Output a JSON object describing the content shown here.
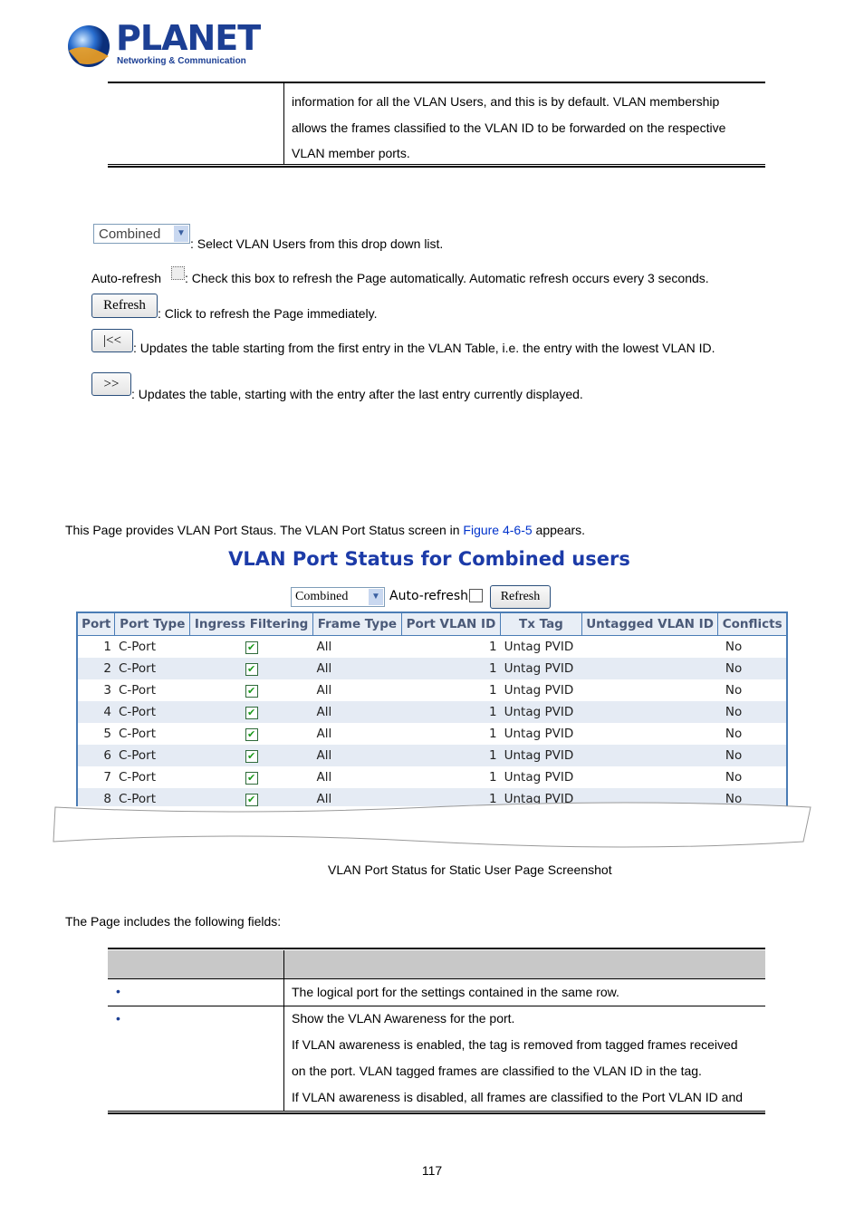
{
  "logo": {
    "name": "PLANET",
    "tagline": "Networking & Communication"
  },
  "top_table": {
    "lines": [
      "information for all the VLAN Users, and this is by default. VLAN membership",
      "allows the frames classified to the VLAN ID to be forwarded on the respective",
      "VLAN member ports."
    ]
  },
  "controls": {
    "select_value": "Combined",
    "select_desc": ": Select VLAN Users from this drop down list.",
    "autorefresh_label": "Auto-refresh",
    "autorefresh_desc": ": Check this box to refresh the Page automatically. Automatic refresh occurs every 3 seconds.",
    "refresh_label": "Refresh",
    "refresh_desc": ": Click to refresh the Page immediately.",
    "first_label": "|<<",
    "first_desc": ": Updates the table starting from the first entry in the VLAN Table, i.e. the entry with the lowest VLAN ID.",
    "next_label": ">>",
    "next_desc": ": Updates the table, starting with the entry after the last entry currently displayed."
  },
  "intro": {
    "before": "This Page provides VLAN Port Staus. The VLAN Port Status screen in ",
    "link": "Figure 4-6-5",
    "after": " appears."
  },
  "screenshot": {
    "title": "VLAN Port Status for Combined users",
    "select_value": "Combined",
    "autorefresh_label": "Auto-refresh",
    "refresh_label": "Refresh",
    "headers": [
      "Port",
      "Port Type",
      "Ingress Filtering",
      "Frame Type",
      "Port VLAN ID",
      "Tx Tag",
      "Untagged VLAN ID",
      "Conflicts"
    ],
    "rows": [
      {
        "port": "1",
        "type": "C-Port",
        "ingress": true,
        "frame": "All",
        "pvid": "1",
        "tx": "Untag PVID",
        "untagged": "",
        "conflicts": "No"
      },
      {
        "port": "2",
        "type": "C-Port",
        "ingress": true,
        "frame": "All",
        "pvid": "1",
        "tx": "Untag PVID",
        "untagged": "",
        "conflicts": "No"
      },
      {
        "port": "3",
        "type": "C-Port",
        "ingress": true,
        "frame": "All",
        "pvid": "1",
        "tx": "Untag PVID",
        "untagged": "",
        "conflicts": "No"
      },
      {
        "port": "4",
        "type": "C-Port",
        "ingress": true,
        "frame": "All",
        "pvid": "1",
        "tx": "Untag PVID",
        "untagged": "",
        "conflicts": "No"
      },
      {
        "port": "5",
        "type": "C-Port",
        "ingress": true,
        "frame": "All",
        "pvid": "1",
        "tx": "Untag PVID",
        "untagged": "",
        "conflicts": "No"
      },
      {
        "port": "6",
        "type": "C-Port",
        "ingress": true,
        "frame": "All",
        "pvid": "1",
        "tx": "Untag PVID",
        "untagged": "",
        "conflicts": "No"
      },
      {
        "port": "7",
        "type": "C-Port",
        "ingress": true,
        "frame": "All",
        "pvid": "1",
        "tx": "Untag PVID",
        "untagged": "",
        "conflicts": "No"
      },
      {
        "port": "8",
        "type": "C-Port",
        "ingress": true,
        "frame": "All",
        "pvid": "1",
        "tx": "Untag PVID",
        "untagged": "",
        "conflicts": "No"
      }
    ],
    "caption": "VLAN Port Status for Static User Page Screenshot"
  },
  "fields_intro": "The Page includes the following fields:",
  "fields_table": {
    "rows": [
      {
        "bullet": "•",
        "lines": [
          "The logical port for the settings contained in the same row."
        ]
      },
      {
        "bullet": "•",
        "lines": [
          "Show the VLAN Awareness for the port.",
          "If VLAN awareness is enabled, the tag is removed from tagged frames received",
          "on the port. VLAN tagged frames are classified to the VLAN ID in the tag.",
          "If VLAN awareness is disabled, all frames are classified to the Port VLAN ID and"
        ]
      }
    ]
  },
  "page_number": "117"
}
